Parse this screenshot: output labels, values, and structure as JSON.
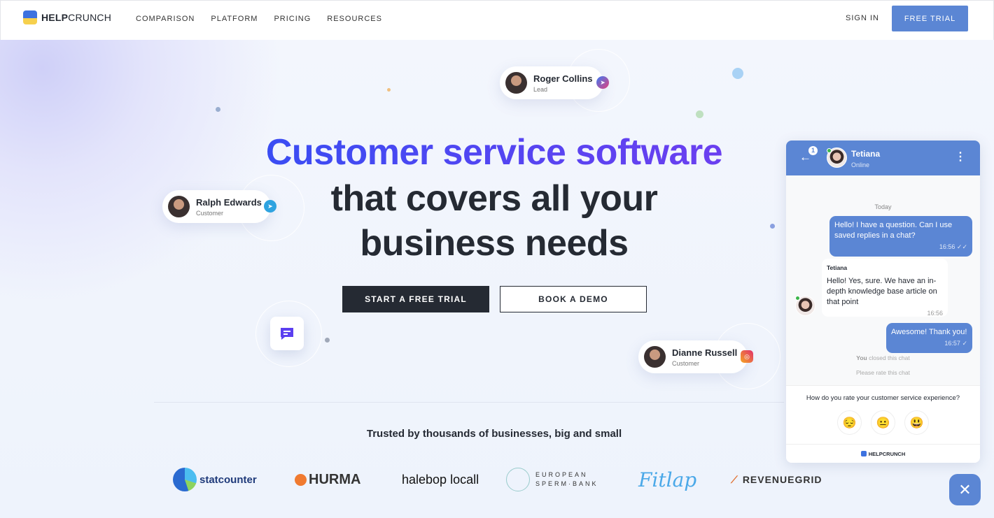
{
  "header": {
    "logo_bold": "HELP",
    "logo_light": "CRUNCH",
    "nav": [
      "COMPARISON",
      "PLATFORM",
      "PRICING",
      "RESOURCES"
    ],
    "sign_in": "SIGN IN",
    "free_trial": "FREE TRIAL"
  },
  "hero": {
    "title_line1": "Customer service software",
    "title_line2": "that covers all your",
    "title_line3": "business needs",
    "cta_primary": "START A FREE TRIAL",
    "cta_secondary": "BOOK A DEMO"
  },
  "contacts": [
    {
      "name": "Roger Collins",
      "role": "Lead",
      "channel": "messenger-icon"
    },
    {
      "name": "Ralph Edwards",
      "role": "Customer",
      "channel": "telegram-icon"
    },
    {
      "name": "Dianne Russell",
      "role": "Customer",
      "channel": "instagram-icon"
    }
  ],
  "trusted": {
    "heading": "Trusted by thousands of businesses, big and small",
    "logos": [
      "statcounter",
      "HURMA",
      "halebop locall",
      "EUROPEAN",
      "SPERM·BANK",
      "Fitlap",
      "REVENUEGRID"
    ]
  },
  "chat": {
    "badge": "1",
    "agent": "Tetiana",
    "status": "Online",
    "date": "Today",
    "messages": [
      {
        "text": "Hello! I have a question. Can I use saved replies in a chat?",
        "time": "16:56",
        "ticks": "✓✓"
      },
      {
        "from": "Tetiana",
        "text": "Hello! Yes, sure. We have an in-depth knowledge base article on that point",
        "time": "16:56"
      },
      {
        "text": "Awesome! Thank you!",
        "time": "16:57",
        "ticks": "✓"
      }
    ],
    "closed_you": "You",
    "closed_rest": " closed this chat",
    "rate_prompt": "Please rate this chat",
    "question": "How do you rate your customer service experience?",
    "emojis": [
      "😔",
      "😐",
      "😃"
    ],
    "powered": "HELPCRUNCH"
  },
  "colors": {
    "accent": "#5b86d4",
    "dark": "#252a33",
    "gradient_start": "#3a4cf3",
    "gradient_end": "#6b3ff0"
  }
}
